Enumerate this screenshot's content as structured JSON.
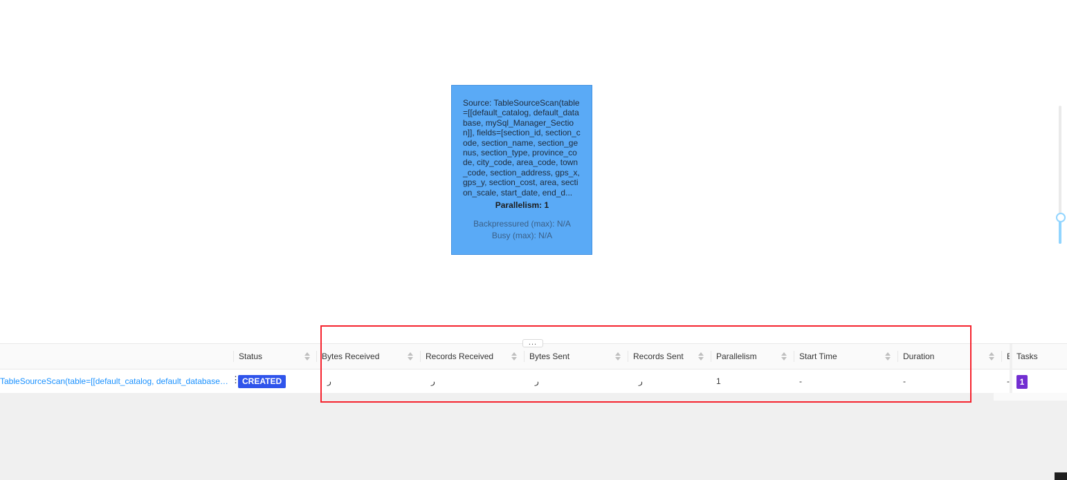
{
  "node": {
    "description": "Source: TableSourceScan(table=[[default_catalog, default_database, mySql_Manager_Section]], fields=[section_id, section_code, section_name, section_genus, section_type, province_code, city_code, area_code, town_code, section_address, gps_x, gps_y, section_cost, area, section_scale, start_date, end_d...",
    "parallelism": "Parallelism: 1",
    "backpressured": "Backpressured (max): N/A",
    "busy": "Busy (max): N/A"
  },
  "resizer_label": "...",
  "table": {
    "columns": {
      "status": "Status",
      "bytes_received": "Bytes Received",
      "records_received": "Records Received",
      "bytes_sent": "Bytes Sent",
      "records_sent": "Records Sent",
      "parallelism": "Parallelism",
      "start_time": "Start Time",
      "duration": "Duration",
      "end_time_partial": "E",
      "tasks": "Tasks"
    },
    "row": {
      "name": "TableSourceScan(table=[[default_catalog, default_database, m...",
      "status": "CREATED",
      "bytes_received": "ر",
      "records_received": "ر",
      "bytes_sent": "ر",
      "records_sent": "ر",
      "parallelism": "1",
      "start_time": "-",
      "duration": "-",
      "end_time": "-",
      "tasks": "1"
    }
  },
  "colors": {
    "node_fill": "#5aaaf6",
    "created_tag": "#2f54eb",
    "tasks_tag": "#722ed1",
    "link": "#1890ff",
    "highlight": "#f5222d"
  }
}
